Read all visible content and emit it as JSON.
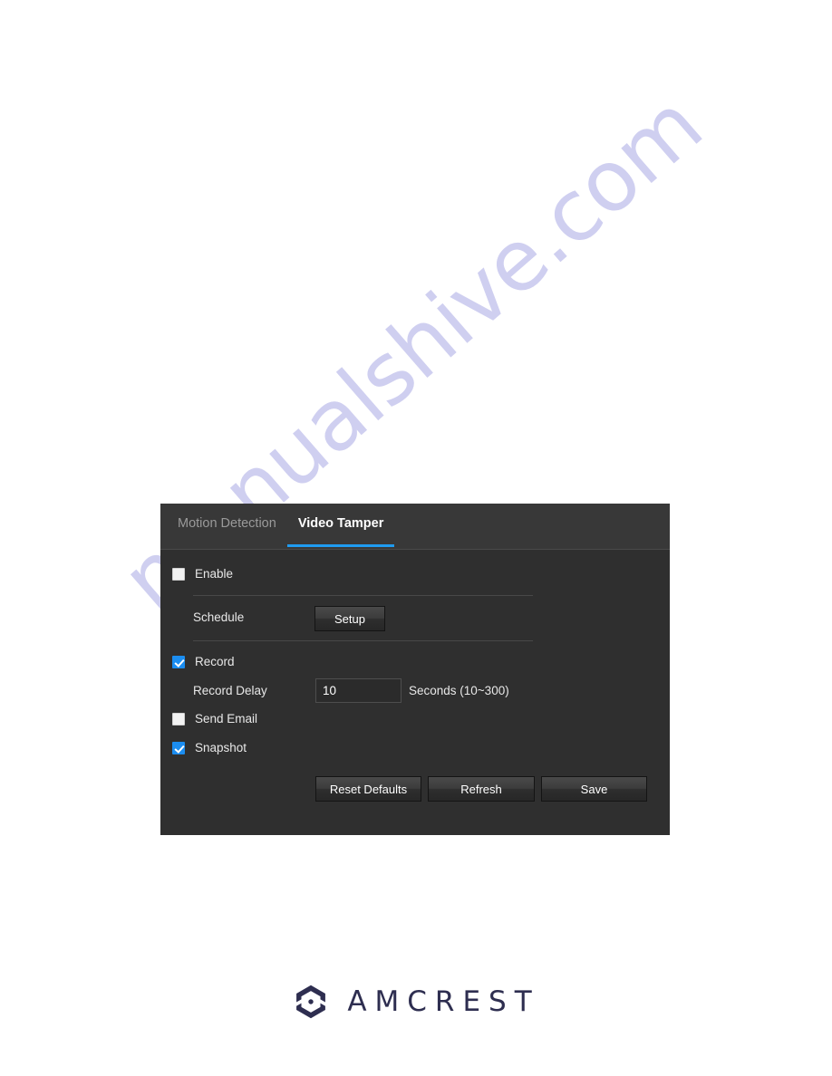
{
  "watermark": {
    "text": "manualshive.com",
    "color": "#cfcff0"
  },
  "panel": {
    "accent_color": "#1f9bf0",
    "background_color": "#2f2f2f",
    "tabbar_color": "#383838",
    "tabs": [
      {
        "label": "Motion Detection",
        "active": false
      },
      {
        "label": "Video Tamper",
        "active": true
      }
    ],
    "fields": {
      "enable": {
        "label": "Enable",
        "checked": false
      },
      "schedule": {
        "label": "Schedule",
        "button_label": "Setup"
      },
      "record": {
        "label": "Record",
        "checked": true
      },
      "record_delay": {
        "label": "Record Delay",
        "value": "10",
        "units": "Seconds (10~300)"
      },
      "send_email": {
        "label": "Send Email",
        "checked": false
      },
      "snapshot": {
        "label": "Snapshot",
        "checked": true
      }
    },
    "actions": {
      "reset_defaults": "Reset Defaults",
      "refresh": "Refresh",
      "save": "Save"
    }
  },
  "footer": {
    "brand": "AMCREST",
    "brand_color": "#2e2e50"
  }
}
